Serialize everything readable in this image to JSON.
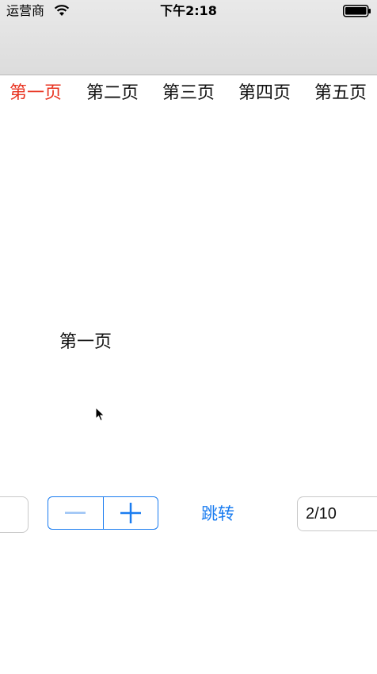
{
  "status_bar": {
    "carrier": "运营商",
    "time": "下午2:18",
    "wifi_icon": "wifi-icon",
    "battery_icon": "battery-icon"
  },
  "tabs": [
    {
      "label": "第一页",
      "active": true
    },
    {
      "label": "第二页",
      "active": false
    },
    {
      "label": "第三页",
      "active": false
    },
    {
      "label": "第四页",
      "active": false
    },
    {
      "label": "第五页",
      "active": false
    }
  ],
  "content": {
    "page_label": "第一页"
  },
  "controls": {
    "stepper_minus_icon": "minus-icon",
    "stepper_plus_icon": "plus-icon",
    "jump_label": "跳转",
    "page_input_value": "2/10"
  },
  "colors": {
    "accent": "#1a7cf0",
    "active_tab": "#e8321f",
    "disabled_minus": "#9cc4f5"
  }
}
